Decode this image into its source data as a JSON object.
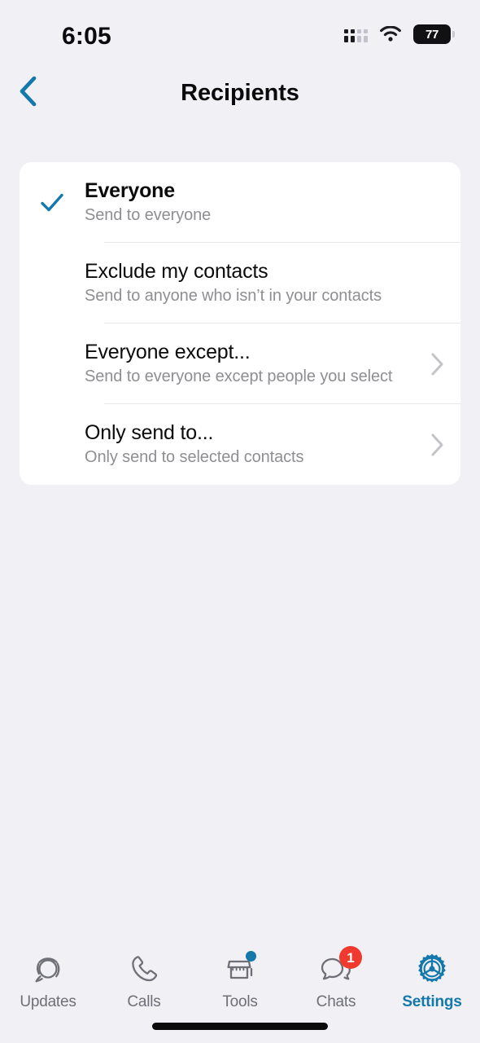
{
  "status_bar": {
    "time": "6:05",
    "cellular_icon": "cellular-signal-icon",
    "wifi_icon": "wifi-icon",
    "battery_level": "77",
    "battery_icon": "battery-icon"
  },
  "nav": {
    "back_icon": "chevron-left-icon",
    "title": "Recipients"
  },
  "options": [
    {
      "title": "Everyone",
      "subtitle": "Send to everyone",
      "selected": true,
      "has_chevron": false,
      "name": "option-everyone"
    },
    {
      "title": "Exclude my contacts",
      "subtitle": "Send to anyone who isn’t in your contacts",
      "selected": false,
      "has_chevron": false,
      "name": "option-exclude-my-contacts"
    },
    {
      "title": "Everyone except...",
      "subtitle": "Send to everyone except people you select",
      "selected": false,
      "has_chevron": true,
      "name": "option-everyone-except"
    },
    {
      "title": "Only send to...",
      "subtitle": "Only send to selected contacts",
      "selected": false,
      "has_chevron": true,
      "name": "option-only-send-to"
    }
  ],
  "tabs": [
    {
      "label": "Updates",
      "icon": "updates-icon",
      "active": false,
      "badge": null,
      "dot": false
    },
    {
      "label": "Calls",
      "icon": "calls-icon",
      "active": false,
      "badge": null,
      "dot": false
    },
    {
      "label": "Tools",
      "icon": "tools-icon",
      "active": false,
      "badge": null,
      "dot": true
    },
    {
      "label": "Chats",
      "icon": "chats-icon",
      "active": false,
      "badge": "1",
      "dot": false
    },
    {
      "label": "Settings",
      "icon": "settings-icon",
      "active": true,
      "badge": null,
      "dot": false
    }
  ],
  "colors": {
    "accent": "#1478ab",
    "background": "#f0f0f5",
    "card": "#ffffff",
    "primary_text": "#0b0b0c",
    "secondary_text": "#8e8e93",
    "divider": "#e8e8ec",
    "badge_red": "#f03a2f",
    "tab_inactive": "#6f6f77"
  }
}
